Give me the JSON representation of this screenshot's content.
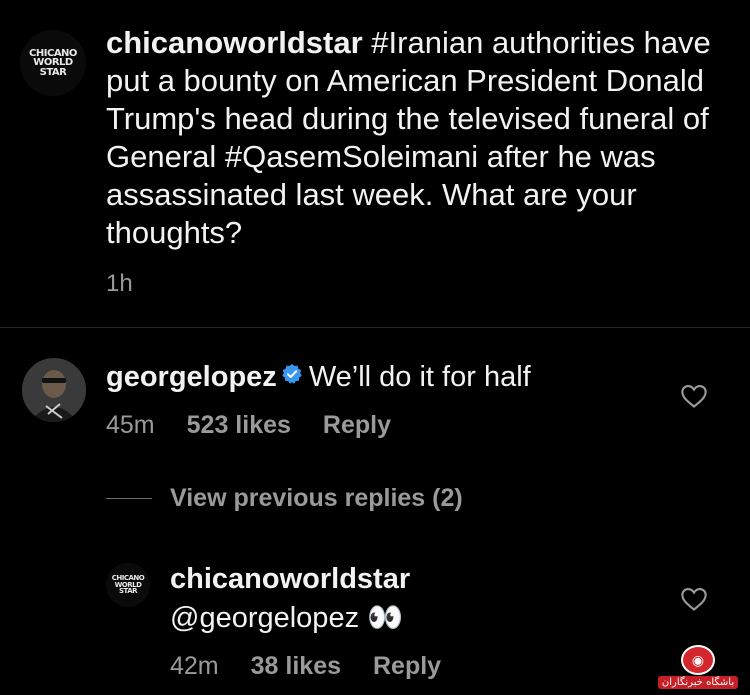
{
  "post": {
    "avatar_logo_line1": "CHICANO",
    "avatar_logo_line2": "WORLD STAR",
    "username": "chicanoworldstar",
    "caption_text": " #Iranian authorities have put a bounty on American President Donald Trump's head during the televised funeral of General #QasemSoleimani after he was assassinated last week. What are your thoughts?",
    "time": "1h"
  },
  "comment": {
    "username": "georgelopez",
    "verified_icon": "verified-badge-icon",
    "text": "We’ll do it for half",
    "time": "45m",
    "likes": "523 likes",
    "reply_label": "Reply",
    "heart_icon": "heart-outline-icon"
  },
  "view_previous": {
    "label": "View previous replies (2)"
  },
  "reply": {
    "avatar_logo_line1": "CHICANO",
    "avatar_logo_line2": "WORLD STAR",
    "username": "chicanoworldstar",
    "text": "@georgelopez 👀",
    "time": "42m",
    "likes": "38 likes",
    "reply_label": "Reply",
    "heart_icon": "heart-outline-icon"
  },
  "watermark": {
    "text": "باشگاه خبرنگاران"
  },
  "colors": {
    "background": "#000000",
    "text": "#f2f2f2",
    "muted": "#9a9a9a",
    "verified": "#3897f0"
  }
}
